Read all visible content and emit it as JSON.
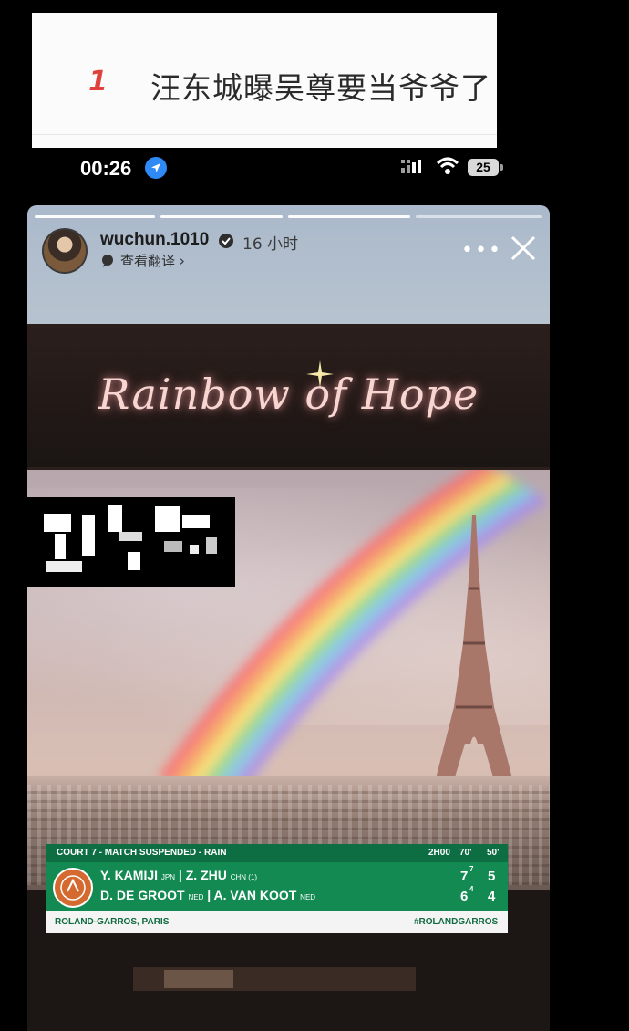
{
  "trending": {
    "rank": "1",
    "title": "汪东城曝吴尊要当爷爷了"
  },
  "status_bar": {
    "time": "00:26",
    "battery": "25",
    "icons": [
      "location-arrow-icon",
      "signal-icon",
      "wifi-icon",
      "battery-icon"
    ]
  },
  "story": {
    "username": "wuchun.1010",
    "posted": "16 小时",
    "translate": "查看翻译 ›",
    "progress_segments": 4,
    "progress_done": 3,
    "icons": [
      "more-options-icon",
      "close-icon"
    ]
  },
  "photo": {
    "overlay_text": "Rainbow of Hope"
  },
  "scoreboard": {
    "header": "COURT 7 - MATCH SUSPENDED - RAIN",
    "duration": "2H00",
    "set1_time": "70'",
    "set2_time": "50'",
    "team1": {
      "p1": "Y. KAMIJI",
      "p1_country": "JPN",
      "p2": "Z. ZHU",
      "p2_country": "CHN (1)",
      "set1": "7",
      "set1_tb": "7",
      "set2": "5"
    },
    "team2": {
      "p1": "D. DE GROOT",
      "p1_country": "NED",
      "p2": "A. VAN KOOT",
      "p2_country": "NED",
      "set1": "6",
      "set1_tb": "4",
      "set2": "4"
    },
    "footer_left": "ROLAND-GARROS, PARIS",
    "footer_right": "#ROLANDGARROS",
    "accent": "#128a52"
  }
}
